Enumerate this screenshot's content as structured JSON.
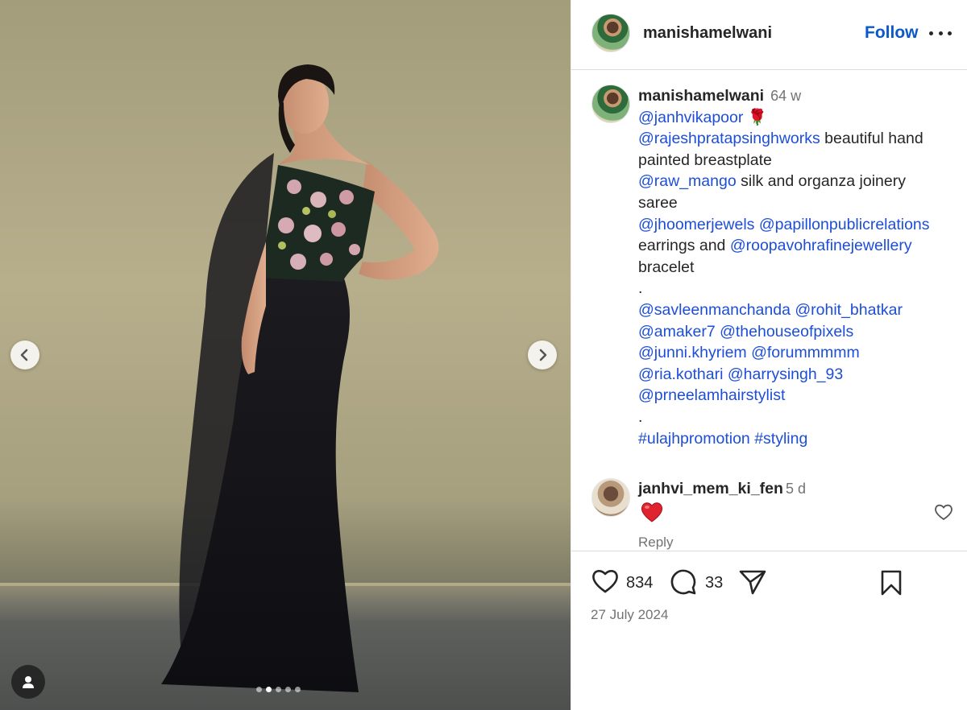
{
  "post": {
    "username": "manishamelwani",
    "follow_label": "Follow",
    "more_label": "More options"
  },
  "carousel": {
    "slide_count": 5,
    "active_index": 1
  },
  "caption": {
    "username": "manishamelwani",
    "time": "64 w",
    "lines": [
      {
        "parts": [
          {
            "t": "@janhvikapoor",
            "m": true
          },
          {
            "t": " 🌹",
            "m": false
          }
        ]
      },
      {
        "parts": [
          {
            "t": "@rajeshpratapsinghworks",
            "m": true
          },
          {
            "t": " beautiful hand",
            "m": false
          }
        ]
      },
      {
        "parts": [
          {
            "t": "painted breastplate",
            "m": false
          }
        ]
      },
      {
        "parts": [
          {
            "t": "@raw_mango",
            "m": true
          },
          {
            "t": " silk and organza joinery",
            "m": false
          }
        ]
      },
      {
        "parts": [
          {
            "t": "saree",
            "m": false
          }
        ]
      },
      {
        "parts": [
          {
            "t": "@jhoomerjewels",
            "m": true
          },
          {
            "t": " ",
            "m": false
          },
          {
            "t": "@papillonpublicrelations",
            "m": true
          }
        ]
      },
      {
        "parts": [
          {
            "t": "earrings and ",
            "m": false
          },
          {
            "t": "@roopavohrafinejewellery",
            "m": true
          }
        ]
      },
      {
        "parts": [
          {
            "t": "bracelet",
            "m": false
          }
        ]
      },
      {
        "parts": [
          {
            "t": ".",
            "m": false
          }
        ]
      },
      {
        "parts": [
          {
            "t": "@savleenmanchanda",
            "m": true
          },
          {
            "t": " ",
            "m": false
          },
          {
            "t": "@rohit_bhatkar",
            "m": true
          }
        ]
      },
      {
        "parts": [
          {
            "t": "@amaker7",
            "m": true
          },
          {
            "t": " ",
            "m": false
          },
          {
            "t": "@thehouseofpixels",
            "m": true
          }
        ]
      },
      {
        "parts": [
          {
            "t": "@junni.khyriem",
            "m": true
          },
          {
            "t": " ",
            "m": false
          },
          {
            "t": "@forummmmm",
            "m": true
          }
        ]
      },
      {
        "parts": [
          {
            "t": "@ria.kothari",
            "m": true
          },
          {
            "t": " ",
            "m": false
          },
          {
            "t": "@harrysingh_93",
            "m": true
          }
        ]
      },
      {
        "parts": [
          {
            "t": "@prneelamhairstylist",
            "m": true
          }
        ]
      },
      {
        "parts": [
          {
            "t": ".",
            "m": false
          }
        ]
      },
      {
        "parts": [
          {
            "t": "#ulajhpromotion",
            "m": true
          },
          {
            "t": " ",
            "m": false
          },
          {
            "t": "#styling",
            "m": true
          }
        ]
      }
    ]
  },
  "comment": {
    "username": "janhvi_mem_ki_fen",
    "time": "5 d",
    "emoji": "red-heart",
    "reply_label": "Reply"
  },
  "actions": {
    "likes": "834",
    "comments": "33",
    "date": "27 July 2024"
  },
  "colors": {
    "link": "#1d4ed8",
    "follow": "#0a58ca",
    "muted": "#737373",
    "heart": "#e0242f"
  },
  "icons": [
    "chevron-left-icon",
    "chevron-right-icon",
    "user-tag-icon",
    "more-icon",
    "heart-icon",
    "comment-icon",
    "share-icon",
    "bookmark-icon"
  ]
}
